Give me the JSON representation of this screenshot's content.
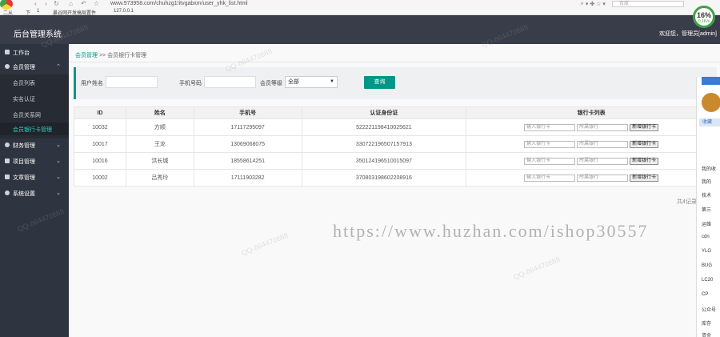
{
  "browser": {
    "url": "www.973958.com/chuhzg1!itvgabxm/user_yhk_list.html",
    "bookmarks": [
      "二从",
      "下",
      "1",
      "暴谷网开发搞局置件",
      "127.0.0.1"
    ],
    "search_placeholder": "百度",
    "speed_percent": "16%",
    "speed_rate": "0.1K/s"
  },
  "header": {
    "app_title": "后台管理系统",
    "user_info": "欢迎您，管理员[admin]"
  },
  "sidebar": {
    "items": [
      {
        "label": "工作台"
      },
      {
        "label": "会员管理",
        "expanded": true
      },
      {
        "label": "财务管理"
      },
      {
        "label": "项目管理"
      },
      {
        "label": "文章管理"
      },
      {
        "label": "系统设置"
      }
    ],
    "subitems": [
      {
        "label": "会员列表"
      },
      {
        "label": "实名认证"
      },
      {
        "label": "会员关系网"
      },
      {
        "label": "会员银行卡管理",
        "active": true
      }
    ]
  },
  "breadcrumb": {
    "home": "会员管理",
    "sep": ">>",
    "current": "会员银行卡管理"
  },
  "filter": {
    "username_label": "用户姓名",
    "phone_label": "手机号码",
    "level_label": "会员等级",
    "level_value": "全部",
    "query_label": "查询"
  },
  "table": {
    "columns": [
      "ID",
      "姓名",
      "手机号",
      "认证身份证",
      "银行卡列表"
    ],
    "card_placeholder": "输入银行卡",
    "bank_placeholder": "所属银行",
    "add_label": "新增银行卡",
    "rows": [
      {
        "id": "10032",
        "name": "方顺",
        "phone": "17117295097",
        "idcard": "522221198410025621"
      },
      {
        "id": "10017",
        "name": "王龙",
        "phone": "13069068075",
        "idcard": "330722196507157913"
      },
      {
        "id": "10016",
        "name": "洪长城",
        "phone": "18558614251",
        "idcard": "350124196510015097"
      },
      {
        "id": "10002",
        "name": "吕秀玲",
        "phone": "17111903282",
        "idcard": "370803198602208916"
      }
    ],
    "total": "共4记录"
  },
  "side_panel": {
    "blue_item": "收藏",
    "items": [
      "我的收",
      "我的",
      "技术",
      "第三",
      "运维",
      "cdn",
      "YLG",
      "BUG",
      "LC20",
      "CP",
      "公众号",
      "库存",
      "资金"
    ]
  },
  "watermark": {
    "url": "https://www.huzhan.com/ishop30557",
    "qq": "QQ-664470688"
  }
}
